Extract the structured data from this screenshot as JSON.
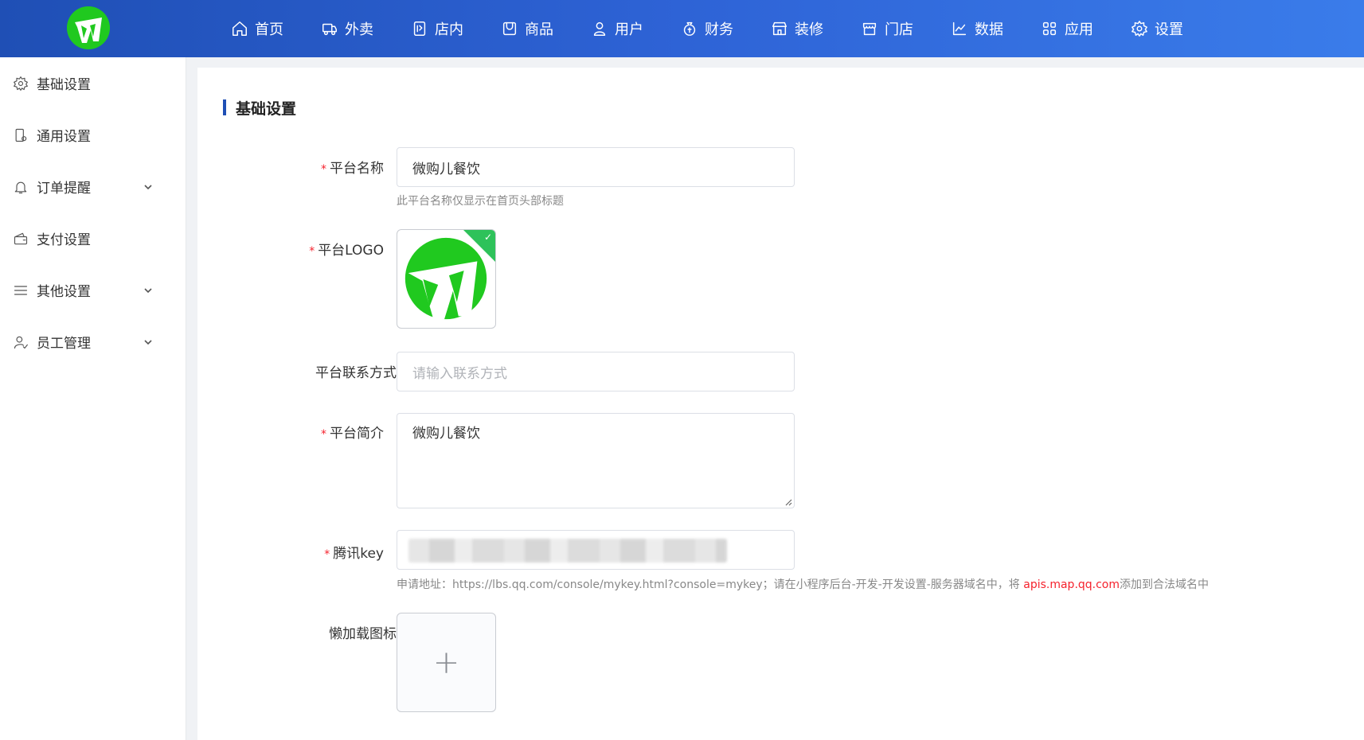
{
  "header": {
    "logo_name": "w-logo",
    "nav": [
      {
        "label": "首页",
        "icon": "home-icon"
      },
      {
        "label": "外卖",
        "icon": "takeout-icon"
      },
      {
        "label": "店内",
        "icon": "dine-in-icon"
      },
      {
        "label": "商品",
        "icon": "goods-icon"
      },
      {
        "label": "用户",
        "icon": "user-icon"
      },
      {
        "label": "财务",
        "icon": "finance-icon"
      },
      {
        "label": "装修",
        "icon": "decoration-icon"
      },
      {
        "label": "门店",
        "icon": "store-icon"
      },
      {
        "label": "数据",
        "icon": "chart-icon"
      },
      {
        "label": "应用",
        "icon": "apps-icon"
      },
      {
        "label": "设置",
        "icon": "gear-icon"
      }
    ]
  },
  "sidebar": {
    "items": [
      {
        "label": "基础设置",
        "icon": "gear-icon",
        "expandable": false
      },
      {
        "label": "通用设置",
        "icon": "phone-settings-icon",
        "expandable": false
      },
      {
        "label": "订单提醒",
        "icon": "bell-icon",
        "expandable": true
      },
      {
        "label": "支付设置",
        "icon": "wallet-icon",
        "expandable": false
      },
      {
        "label": "其他设置",
        "icon": "menu-lines-icon",
        "expandable": true
      },
      {
        "label": "员工管理",
        "icon": "staff-icon",
        "expandable": true
      }
    ]
  },
  "form": {
    "title": "基础设置",
    "platform_name": {
      "label": "平台名称",
      "required": "*",
      "value": "微购儿餐饮",
      "hint": "此平台名称仅显示在首页头部标题"
    },
    "platform_logo": {
      "label": "平台LOGO",
      "required": "*"
    },
    "platform_contact": {
      "label": "平台联系方式",
      "placeholder": "请输入联系方式",
      "value": ""
    },
    "platform_intro": {
      "label": "平台简介",
      "required": "*",
      "value": "微购儿餐饮"
    },
    "tencent_key": {
      "label": "腾讯key",
      "required": "*",
      "hint_prefix": "申请地址：https://lbs.qq.com/console/mykey.html?console=mykey；请在小程序后台-开发-开发设置-服务器域名中，将 ",
      "hint_domain": "apis.map.qq.com",
      "hint_suffix": "添加到合法域名中"
    },
    "lazy_icon": {
      "label": "懒加载图标",
      "upload_symbol": "+"
    }
  },
  "colors": {
    "accent": "#1f4fb5",
    "required": "#f5222d",
    "logo_green": "#20c91f",
    "success": "#2ec25a"
  }
}
